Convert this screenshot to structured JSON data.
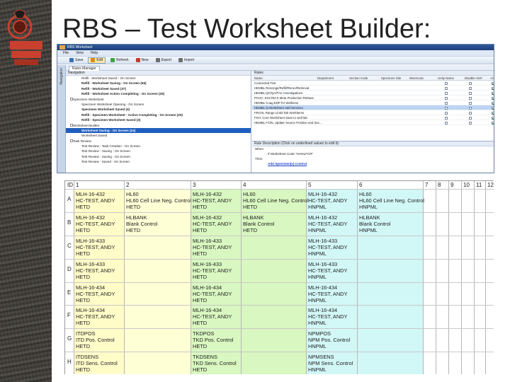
{
  "slide_title": "RBS – Test Worksheet Builder:",
  "app": {
    "window_title": "RBS Worksheet",
    "menus": [
      "File",
      "View",
      "Help"
    ],
    "toolbar": [
      "Save",
      "Edit",
      "Refresh",
      "New",
      "Export",
      "Import"
    ],
    "left_rail_label": "Navigation",
    "tab": "Rules Manager",
    "nav_header": "Navigation",
    "tree": [
      {
        "text": "Refill - Worksheet Saved - On Screen",
        "bold": false,
        "indent": 2
      },
      {
        "text": "Refill - Worksheet Saving - On Screen (55)",
        "bold": true,
        "indent": 2
      },
      {
        "text": "Refill - Worksheet Saved (37)",
        "bold": true,
        "indent": 2
      },
      {
        "text": "Refill - Worksheet Action Completing - On Screen (25)",
        "bold": true,
        "indent": 2
      },
      {
        "text": "Specimen Worksheet",
        "bold": false,
        "indent": 1,
        "exp": true
      },
      {
        "text": "Specimen Worksheet Opening - On Screen",
        "bold": false,
        "indent": 2
      },
      {
        "text": "Specimen Worksheet Saved (4)",
        "bold": true,
        "indent": 2
      },
      {
        "text": "Refill - Specimen Worksheet - Action Completing - On Screen (20)",
        "bold": true,
        "indent": 2
      },
      {
        "text": "Refill - Specimen Worksheet Saved (3)",
        "bold": true,
        "indent": 2
      },
      {
        "text": "Worksheet Builder",
        "bold": false,
        "indent": 1,
        "exp": true
      },
      {
        "text": "Worksheet Saving - On Screen (24)",
        "bold": true,
        "indent": 2,
        "selected": true
      },
      {
        "text": "Worksheet Saved",
        "bold": false,
        "indent": 2
      },
      {
        "text": "Task Review",
        "bold": false,
        "indent": 1,
        "exp": true
      },
      {
        "text": "Test Review - Task Creation - On Screen",
        "bold": false,
        "indent": 2
      },
      {
        "text": "Test Review - Saving - On Screen",
        "bold": false,
        "indent": 2
      },
      {
        "text": "Test Review - Saving - On Screen",
        "bold": false,
        "indent": 2
      },
      {
        "text": "Test Review - Saved - On Screen",
        "bold": false,
        "indent": 2
      }
    ],
    "grid_title": "Rules",
    "grid_columns": [
      "Name",
      "Department",
      "Section Code",
      "Specimen Site",
      "Mnemonic",
      "Unity Name",
      "Disable Alert",
      "Active"
    ],
    "grid_rows": [
      {
        "name": "Connected Test",
        "checks": [
          false,
          false,
          true
        ]
      },
      {
        "name": "HEMBL Rescinge/Refill/Rerun/Retrieval",
        "checks": [
          false,
          false,
          true
        ]
      },
      {
        "name": "HEMBL QC/QA/FAC Investigations",
        "checks": [
          false,
          false,
          true
        ]
      },
      {
        "name": "PCHC: ESC/NCS Meta Production Rebase",
        "checks": [
          false,
          false,
          true
        ]
      },
      {
        "name": "HEMBL Coag EDP for Wellness",
        "checks": [
          false,
          false,
          true
        ]
      },
      {
        "name": "HEMBL Q-Worksheet Add Services",
        "checks": [
          false,
          false,
          true
        ],
        "selected": true
      },
      {
        "name": "FRCHL Range Linkit Tab Workitems",
        "checks": [
          false,
          false,
          true
        ]
      },
      {
        "name": "FSH: Core Worksheet Save to well lab",
        "checks": [
          false,
          false,
          true
        ]
      },
      {
        "name": "HEMBL FCRL Update Source Position and Sec...",
        "checks": [
          false,
          false,
          true
        ]
      }
    ],
    "desc_title": "Rule Description (Click on underlined values to edit it):",
    "desc_lines": [
      "When",
      "If Worksheet Code \"HANLFCR\"",
      "Then",
      "Add Specimen(s) Control"
    ]
  },
  "worksheet": {
    "col_labels": [
      "ID",
      "1",
      "2",
      "3",
      "4",
      "5",
      "6",
      "7",
      "8",
      "9",
      "10",
      "11",
      "12"
    ],
    "row_labels": [
      "A",
      "B",
      "C",
      "D",
      "E",
      "F",
      "G",
      "H"
    ],
    "col_colors": [
      "#fffcc8",
      "#ffffd6",
      "#d9f7c0",
      "#d9f7c0",
      "#d2f7f7",
      "#d2f7f7"
    ],
    "cells": [
      [
        [
          "MLH-16-432",
          "HC-TEST, ANDY",
          "HETD"
        ],
        [
          "HL60",
          "HL60 Cell Line Neg. Control",
          "HETD"
        ],
        [
          "MLH-16-432",
          "HC-TEST, ANDY",
          "HETD"
        ],
        [
          "HL60",
          "HL60 Cell Line Neg. Control",
          "HETD"
        ],
        [
          "MLH-16-432",
          "HC-TEST, ANDY",
          "HNPML"
        ],
        [
          "HL60",
          "HL60 Cell Line Neg. Control",
          "HNPML"
        ]
      ],
      [
        [
          "MLH-16-432",
          "HC-TEST, ANDY",
          "HETD"
        ],
        [
          "HLBANK",
          "Blank Control",
          "HETD"
        ],
        [
          "MLH-16-432",
          "HC-TEST, ANDY",
          "HETD"
        ],
        [
          "HLBANK",
          "Blank Control",
          "HETD"
        ],
        [
          "MLH-16-432",
          "HC-TEST, ANDY",
          "HNPML"
        ],
        [
          "HLBANK",
          "Blank Control",
          "HNPML"
        ]
      ],
      [
        [
          "MLH-16-433",
          "HC-TEST, ANDY",
          "HETD"
        ],
        [],
        [
          "MLH-16-433",
          "HC-TEST, ANDY",
          "HETD"
        ],
        [],
        [
          "MLH-16-433",
          "HC-TEST, ANDY",
          "HNPML"
        ],
        []
      ],
      [
        [
          "MLH-16-433",
          "HC-TEST, ANDY",
          "HETD"
        ],
        [],
        [
          "MLH-16-433",
          "HC-TEST, ANDY",
          "HETD"
        ],
        [],
        [
          "MLH-16-433",
          "HC-TEST, ANDY",
          "HNPML"
        ],
        []
      ],
      [
        [
          "MLH-16-434",
          "HC-TEST, ANDY",
          "HETD"
        ],
        [],
        [
          "MLH-16-434",
          "HC-TEST, ANDY",
          "HETD"
        ],
        [],
        [
          "MLH-16-434",
          "HC-TEST, ANDY",
          "HNPML"
        ],
        []
      ],
      [
        [
          "MLH-16-434",
          "HC-TEST, ANDY",
          "HETD"
        ],
        [],
        [
          "MLH-16-434",
          "HC-TEST, ANDY",
          "HETD"
        ],
        [],
        [
          "MLH-16-434",
          "HC-TEST, ANDY",
          "HNPML"
        ],
        []
      ],
      [
        [
          "ITDPOS",
          "ITD Pos. Control",
          "HETD"
        ],
        [],
        [
          "TKDPOS",
          "TKD Pos. Control",
          "HETD"
        ],
        [],
        [
          "NPMPOS",
          "NPM Pos. Control",
          "HNPML"
        ],
        []
      ],
      [
        [
          "ITDSENS",
          "ITD Sens. Control",
          "HETD"
        ],
        [],
        [
          "TKDSENS",
          "TKD Sens. Control",
          "HETD"
        ],
        [],
        [
          "NPMSENS",
          "NPM Sens. Control",
          "HNPML"
        ],
        []
      ]
    ]
  }
}
